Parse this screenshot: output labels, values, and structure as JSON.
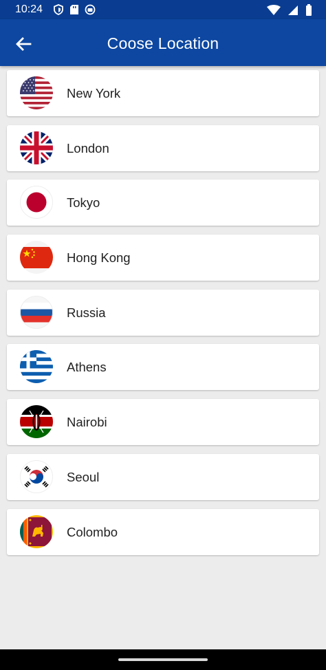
{
  "status": {
    "time": "10:24"
  },
  "appbar": {
    "title": "Coose Location"
  },
  "locations": [
    {
      "name": "New York",
      "flag": "us-flag-icon"
    },
    {
      "name": "London",
      "flag": "uk-flag-icon"
    },
    {
      "name": "Tokyo",
      "flag": "japan-flag-icon"
    },
    {
      "name": "Hong Kong",
      "flag": "china-flag-icon"
    },
    {
      "name": "Russia",
      "flag": "russia-flag-icon"
    },
    {
      "name": "Athens",
      "flag": "greece-flag-icon"
    },
    {
      "name": "Nairobi",
      "flag": "kenya-flag-icon"
    },
    {
      "name": "Seoul",
      "flag": "korea-flag-icon"
    },
    {
      "name": "Colombo",
      "flag": "sri-lanka-flag-icon"
    }
  ],
  "colors": {
    "appbar": "#0d47a1",
    "statusbar": "#0a3d91",
    "background": "#ececec"
  }
}
